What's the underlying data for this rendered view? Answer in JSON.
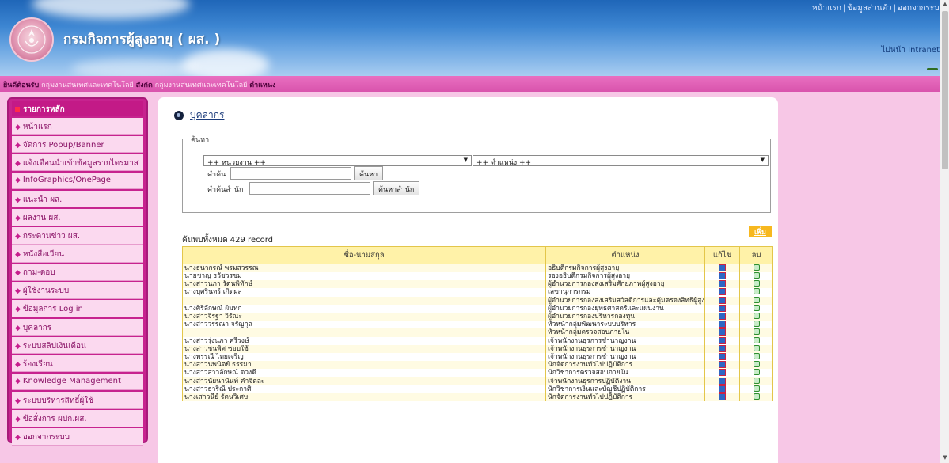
{
  "header": {
    "site_title": "กรมกิจการผู้สูงอายุ ( ผส. )",
    "top_links": [
      "หน้าแรก",
      "ข้อมูลส่วนตัว",
      "ออกจากระบบ"
    ],
    "intranet_link": "ไปหน้า Intranet"
  },
  "welcome": {
    "label1": "ยินดีต้อนรับ",
    "value1": "กลุ่มงานสนเทศและเทคโนโลยี",
    "label2": "สังกัด",
    "value2": "กลุ่มงานสนเทศและเทคโนโลยี",
    "label3": "ตำแหน่ง"
  },
  "sidebar": {
    "title": "รายการหลัก",
    "items": [
      {
        "label": "หน้าแรก"
      },
      {
        "label": "จัดการ Popup/Banner"
      },
      {
        "label": "แจ้งเตือนนำเข้าข้อมูลรายไตรมาส"
      },
      {
        "label": "InfoGraphics/OnePage"
      },
      {
        "label": "แนะนำ ผส."
      },
      {
        "label": "ผลงาน ผส."
      },
      {
        "label": "กระดานข่าว ผส."
      },
      {
        "label": "หนังสือเวียน"
      },
      {
        "label": "ถาม-ตอบ"
      },
      {
        "label": "ผู้ใช้งานระบบ"
      },
      {
        "label": "ข้อมูลการ Log in"
      },
      {
        "label": "บุคลากร"
      },
      {
        "label": "ระบบสลิปเงินเดือน"
      },
      {
        "label": "ร้องเรียน"
      },
      {
        "label": "Knowledge Management"
      },
      {
        "label": "ระบบบริหารสิทธิ์ผู้ใช้"
      },
      {
        "label": "ข้อสั่งการ ผปก.ผส."
      },
      {
        "label": "ออกจากระบบ"
      }
    ]
  },
  "main": {
    "heading": "บุคลากร",
    "search": {
      "legend": "ค้นหา",
      "unit_select": "++ หน่วยงาน ++",
      "position_select": "++ ตำแหน่ง ++",
      "keyword_label": "คำค้น",
      "keyword_value": "",
      "search_button": "ค้นหา",
      "office_label": "คำค้นสำนัก",
      "office_value": "",
      "office_button": "ค้นหาสำนัก"
    },
    "record_count": "ค้นพบทั้งหมด 429 record",
    "add_button": "เพิ่มข้อมูล",
    "table": {
      "headers": [
        "ชื่อ-นามสกุล",
        "ตำแหน่ง",
        "แก้ไข",
        "ลบ"
      ],
      "rows": [
        {
          "name": "นางธนากรณ์ พรมสวรรณ",
          "position": "อธิบดีกรมกิจการผู้สูงอายุ"
        },
        {
          "name": "นายชาญ ธวัชวรชม",
          "position": "รองอธิบดีกรมกิจการผู้สูงอายุ"
        },
        {
          "name": "นางสาวนภา รัตนพิทักษ์",
          "position": "ผู้อำนวยการกองส่งเสริมศักยภาพผู้สูงอายุ"
        },
        {
          "name": "นางบุศรินทร์ เกิดผล",
          "position": "เลขานุการกรม"
        },
        {
          "name": "",
          "position": "ผู้อำนวยการกองส่งเสริมสวัสดิการและคุ้มครองสิทธิผู้สูงอายุ"
        },
        {
          "name": "นางศิริลักษณ์ ผิมทก",
          "position": "ผู้อำนวยการกองยุทธศาสตร์และแผนงาน"
        },
        {
          "name": "นางสาวจิรฐา วิรัณะ",
          "position": "ผู้อำนวยการกองบริหารกองทุน"
        },
        {
          "name": "นางสาววรรณา จรัญกุล",
          "position": "หัวหน้ากลุ่มพัฒนาระบบบริหาร"
        },
        {
          "name": "",
          "position": "หัวหน้ากลุ่มตรวจสอบภายใน"
        },
        {
          "name": "นางสาวรุ่งนภา ศรีวงษ์",
          "position": "เจ้าพนักงานธุรการชำนาญงาน"
        },
        {
          "name": "นางสาวชนพิศ ชอบใช้",
          "position": "เจ้าพนักงานธุรการชำนาญงาน"
        },
        {
          "name": "นางพรรณี ไทยเจริญ",
          "position": "เจ้าพนักงานธุรการชำนาญงาน"
        },
        {
          "name": "นางสาวนพนิตย์ ธรรมา",
          "position": "นักจัดการงานทั่วไปปฏิบัติการ"
        },
        {
          "name": "นางสาวสาวลักษณ์ ดวงดี",
          "position": "นักวิชาการตรวจสอบภายใน"
        },
        {
          "name": "นางสาวนัยนานันท์ คำจิตละ",
          "position": "เจ้าพนักงานธุรการปฏิบัติงาน"
        },
        {
          "name": "นางสาวธาริณี ประกาศิ",
          "position": "นักวิชาการเงินและบัญชีปฏิบัติการ"
        },
        {
          "name": "นางเสาวนีย์ รัตนวิเศษ",
          "position": "นักจัดการงานทั่วไปปฏิบัติการ"
        }
      ]
    }
  }
}
